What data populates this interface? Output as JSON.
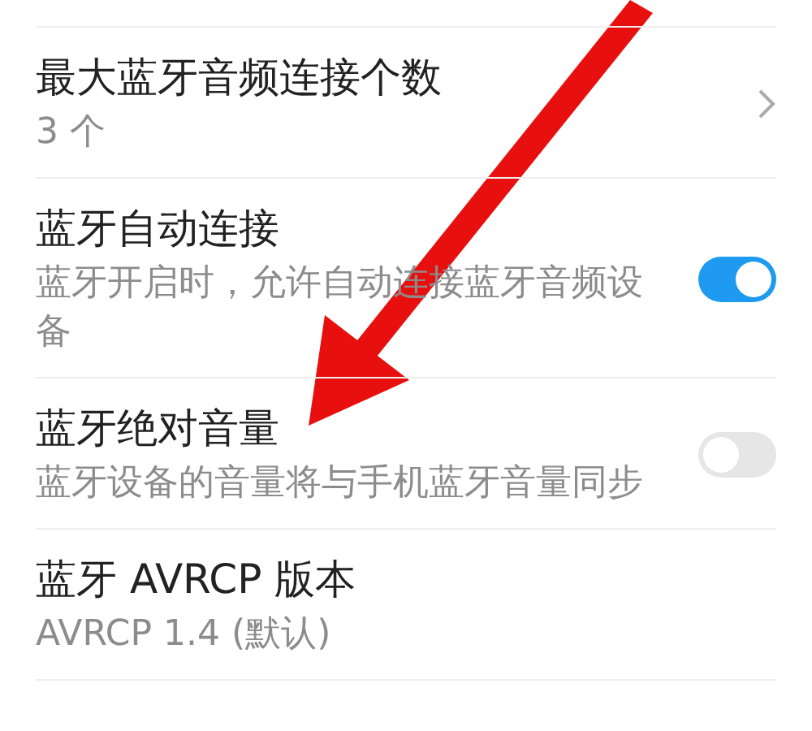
{
  "settings": [
    {
      "kind": "chevron",
      "title": "最大蓝牙音频连接个数",
      "subtitle": "3 个"
    },
    {
      "kind": "toggle",
      "title": "蓝牙自动连接",
      "subtitle": "蓝牙开启时，允许自动连接蓝牙音频设备",
      "on": true
    },
    {
      "kind": "toggle",
      "title": "蓝牙绝对音量",
      "subtitle": "蓝牙设备的音量将与手机蓝牙音量同步",
      "on": false
    },
    {
      "kind": "plain",
      "title": "蓝牙 AVRCP 版本",
      "subtitle": "AVRCP 1.4 (默认)"
    }
  ],
  "annotation": {
    "kind": "arrow"
  }
}
